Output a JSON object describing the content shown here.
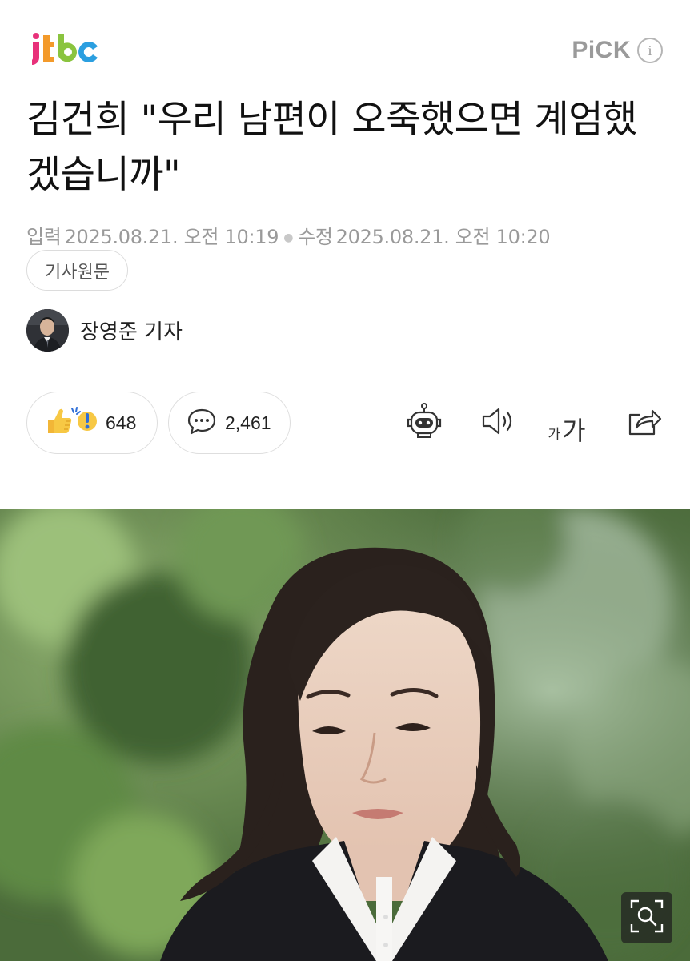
{
  "header": {
    "logo_text": "jtbc",
    "pick_label": "PiCK",
    "info_icon": "info-icon"
  },
  "article": {
    "title": "김건희 \"우리 남편이 오죽했으면 계엄했겠습니까\"",
    "input_label": "입력",
    "input_date": "2025.08.21. 오전 10:19",
    "modified_label": "수정",
    "modified_date": "2025.08.21. 오전 10:20",
    "original_button": "기사원문",
    "reporter": "장영준 기자"
  },
  "actions": {
    "reaction_icon": "thumbs-up-exclaim-icon",
    "reaction_count": "648",
    "comment_icon": "comment-bubble-icon",
    "comment_count": "2,461",
    "summary_icon": "robot-icon",
    "tts_icon": "speaker-icon",
    "font_small": "가",
    "font_big": "가",
    "share_icon": "share-icon"
  },
  "photo": {
    "zoom_icon": "zoom-search-icon"
  },
  "colors": {
    "accent_pick": "#9a9a9a",
    "meta_text": "#9a9a9a",
    "reaction_yellow": "#f7c844",
    "reaction_blue": "#2f6fd8"
  }
}
